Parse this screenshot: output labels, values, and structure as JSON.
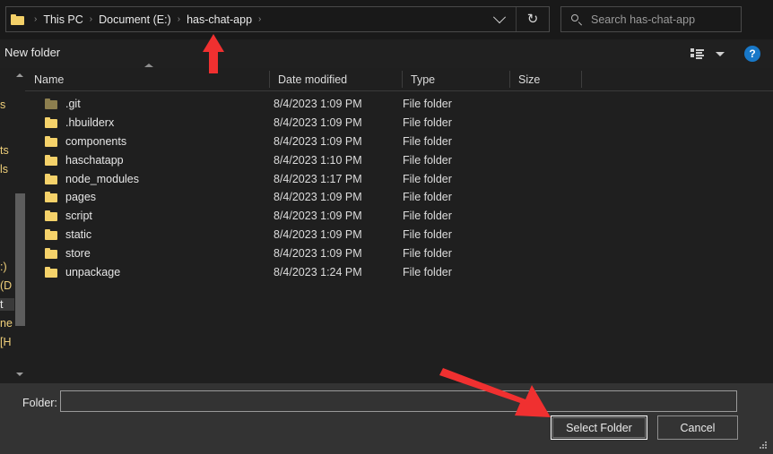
{
  "dialog": {
    "title": "Select Folder",
    "accent_color": "#1878c8",
    "annotation_color": "#f03030"
  },
  "address_bar": {
    "folder_icon": "folder-icon",
    "breadcrumbs": [
      "This PC",
      "Document (E:)",
      "has-chat-app"
    ],
    "separator": "›",
    "history_icon": "chevron-down-icon",
    "refresh_icon": "refresh-icon",
    "refresh_glyph": "↻"
  },
  "search": {
    "icon": "search-icon",
    "placeholder": "Search has-chat-app",
    "value": ""
  },
  "command_bar": {
    "new_folder_label": "New folder",
    "view_icon": "view-layout-icon",
    "view_dropdown_icon": "chevron-down-icon",
    "help_icon": "help-icon",
    "help_label": "?"
  },
  "file_list": {
    "columns": [
      {
        "label": "Name",
        "sorted": "asc"
      },
      {
        "label": "Date modified",
        "sorted": ""
      },
      {
        "label": "Type",
        "sorted": ""
      },
      {
        "label": "Size",
        "sorted": ""
      }
    ],
    "sort_caret_icon": "sort-ascending-icon",
    "rows": [
      {
        "name": ".git",
        "date": "8/4/2023 1:09 PM",
        "type": "File folder",
        "size": "",
        "icon": "folder-icon-hidden"
      },
      {
        "name": ".hbuilderx",
        "date": "8/4/2023 1:09 PM",
        "type": "File folder",
        "size": "",
        "icon": "folder-icon"
      },
      {
        "name": "components",
        "date": "8/4/2023 1:09 PM",
        "type": "File folder",
        "size": "",
        "icon": "folder-icon"
      },
      {
        "name": "haschatapp",
        "date": "8/4/2023 1:10 PM",
        "type": "File folder",
        "size": "",
        "icon": "folder-icon"
      },
      {
        "name": "node_modules",
        "date": "8/4/2023 1:17 PM",
        "type": "File folder",
        "size": "",
        "icon": "folder-icon"
      },
      {
        "name": "pages",
        "date": "8/4/2023 1:09 PM",
        "type": "File folder",
        "size": "",
        "icon": "folder-icon"
      },
      {
        "name": "script",
        "date": "8/4/2023 1:09 PM",
        "type": "File folder",
        "size": "",
        "icon": "folder-icon"
      },
      {
        "name": "static",
        "date": "8/4/2023 1:09 PM",
        "type": "File folder",
        "size": "",
        "icon": "folder-icon"
      },
      {
        "name": "store",
        "date": "8/4/2023 1:09 PM",
        "type": "File folder",
        "size": "",
        "icon": "folder-icon"
      },
      {
        "name": "unpackage",
        "date": "8/4/2023 1:24 PM",
        "type": "File folder",
        "size": "",
        "icon": "folder-icon"
      }
    ]
  },
  "nav_pane_clipped": {
    "fragments": [
      "s",
      "ts",
      "ls",
      ":)",
      "(D",
      "t",
      "ne",
      "[H"
    ]
  },
  "scrollbar": {
    "up_icon": "scroll-up-arrow-icon",
    "down_icon": "scroll-down-arrow-icon"
  },
  "footer": {
    "folder_label": "Folder:",
    "folder_value": "",
    "select_button": "Select Folder",
    "cancel_button": "Cancel",
    "resize_grip_icon": "resize-grip-icon"
  },
  "annotations": [
    {
      "name": "arrow-to-breadcrumb",
      "direction": "up"
    },
    {
      "name": "arrow-to-select-folder",
      "direction": "down-right"
    }
  ]
}
